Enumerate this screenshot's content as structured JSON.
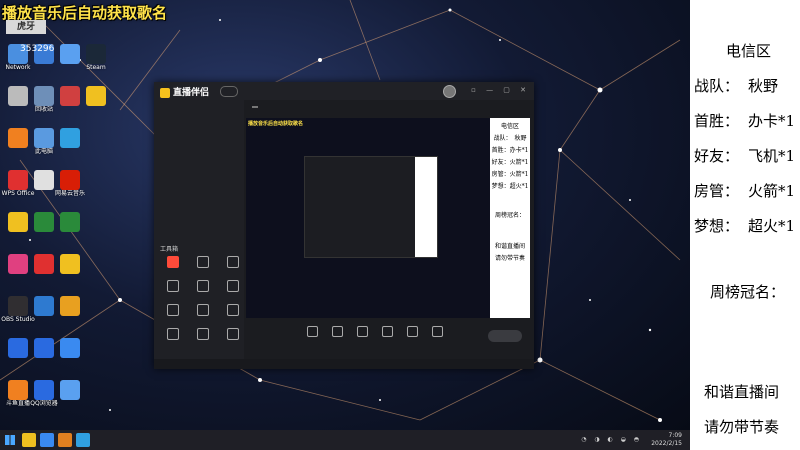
{
  "overlay": {
    "caption": "播放音乐后自动获取歌名",
    "logo_text": "虎牙",
    "number": "353296"
  },
  "desktop_icons": [
    {
      "label": "Network",
      "color": "#4a8fe0"
    },
    {
      "label": "",
      "color": "#3a7bd5"
    },
    {
      "label": "",
      "color": "#5aa0f0"
    },
    {
      "label": "Steam",
      "color": "#1b2838"
    },
    {
      "label": "",
      "color": "#bbbbbb"
    },
    {
      "label": "回收站",
      "color": "#6e8fb8"
    },
    {
      "label": "",
      "color": "#d04040"
    },
    {
      "label": "",
      "color": "#f0c020"
    },
    {
      "label": "",
      "color": "#f08020"
    },
    {
      "label": "此电脑",
      "color": "#5a9ae0"
    },
    {
      "label": "",
      "color": "#30a0e0"
    },
    {
      "label": "WPS Office",
      "color": "#e03030"
    },
    {
      "label": "",
      "color": "#e0e0e0"
    },
    {
      "label": "网易云音乐",
      "color": "#d81e06"
    },
    {
      "label": "",
      "color": "#f0c020"
    },
    {
      "label": "",
      "color": "#2a8a3a"
    },
    {
      "label": "",
      "color": "#2a8a3a"
    },
    {
      "label": "",
      "color": "#e04080"
    },
    {
      "label": "",
      "color": "#e03030"
    },
    {
      "label": "",
      "color": "#f0c020"
    },
    {
      "label": "OBS Studio",
      "color": "#302e31"
    },
    {
      "label": "",
      "color": "#2e7ad0"
    },
    {
      "label": "",
      "color": "#e8a020"
    },
    {
      "label": "",
      "color": "#2a6ae0"
    },
    {
      "label": "",
      "color": "#2a6ae0"
    },
    {
      "label": "",
      "color": "#3a8af0"
    },
    {
      "label": "斗鱼直播",
      "color": "#f08020"
    },
    {
      "label": "QQ浏览器",
      "color": "#2a6ae0"
    },
    {
      "label": "",
      "color": "#5aa0f0"
    }
  ],
  "app": {
    "title": "直播伴侣",
    "version": "",
    "tabs": [
      "",
      "",
      ""
    ],
    "scenes": [
      "",
      "",
      "",
      ""
    ],
    "tools_heading": "工具箱",
    "tools": [
      {
        "label": "",
        "active": true
      },
      {
        "label": "",
        "active": false
      },
      {
        "label": "",
        "active": false
      },
      {
        "label": "",
        "active": false
      },
      {
        "label": "",
        "active": false
      },
      {
        "label": "",
        "active": false
      },
      {
        "label": "",
        "active": false
      },
      {
        "label": "",
        "active": false
      },
      {
        "label": "",
        "active": false
      },
      {
        "label": "",
        "active": false
      },
      {
        "label": "",
        "active": false
      },
      {
        "label": "",
        "active": false
      }
    ],
    "preview_title": "",
    "preview_badge": "",
    "preview_stats": "",
    "preview_caption": "播放音乐后自动获取歌名",
    "bottom_buttons": [
      "",
      "",
      "",
      "",
      "",
      ""
    ],
    "start_button": "",
    "status_text": ""
  },
  "mini_panel": {
    "lines": [
      "电信区",
      "战队：　秋野",
      "首胜：办卡*1",
      "好友：火箭*1",
      "房管：火箭*1",
      "梦想：超火*1",
      "周榜冠名：",
      "和谐直播间",
      "请勿带节奏"
    ]
  },
  "panel": {
    "region": "电信区",
    "rows": [
      {
        "label": "战队：",
        "value": "秋野"
      },
      {
        "label": "首胜：",
        "value": "办卡*1"
      },
      {
        "label": "好友：",
        "value": "飞机*1"
      },
      {
        "label": "房管：",
        "value": "火箭*1"
      },
      {
        "label": "梦想：",
        "value": "超火*1"
      }
    ],
    "weekly_title": "周榜冠名：",
    "footer1": "和谐直播间",
    "footer2": "请勿带节奏"
  },
  "taskbar": {
    "time": "7:09",
    "date": "2022/2/15",
    "pinned_colors": [
      "#f0c020",
      "#3a8af0",
      "#e08020",
      "#30a0e0"
    ]
  }
}
